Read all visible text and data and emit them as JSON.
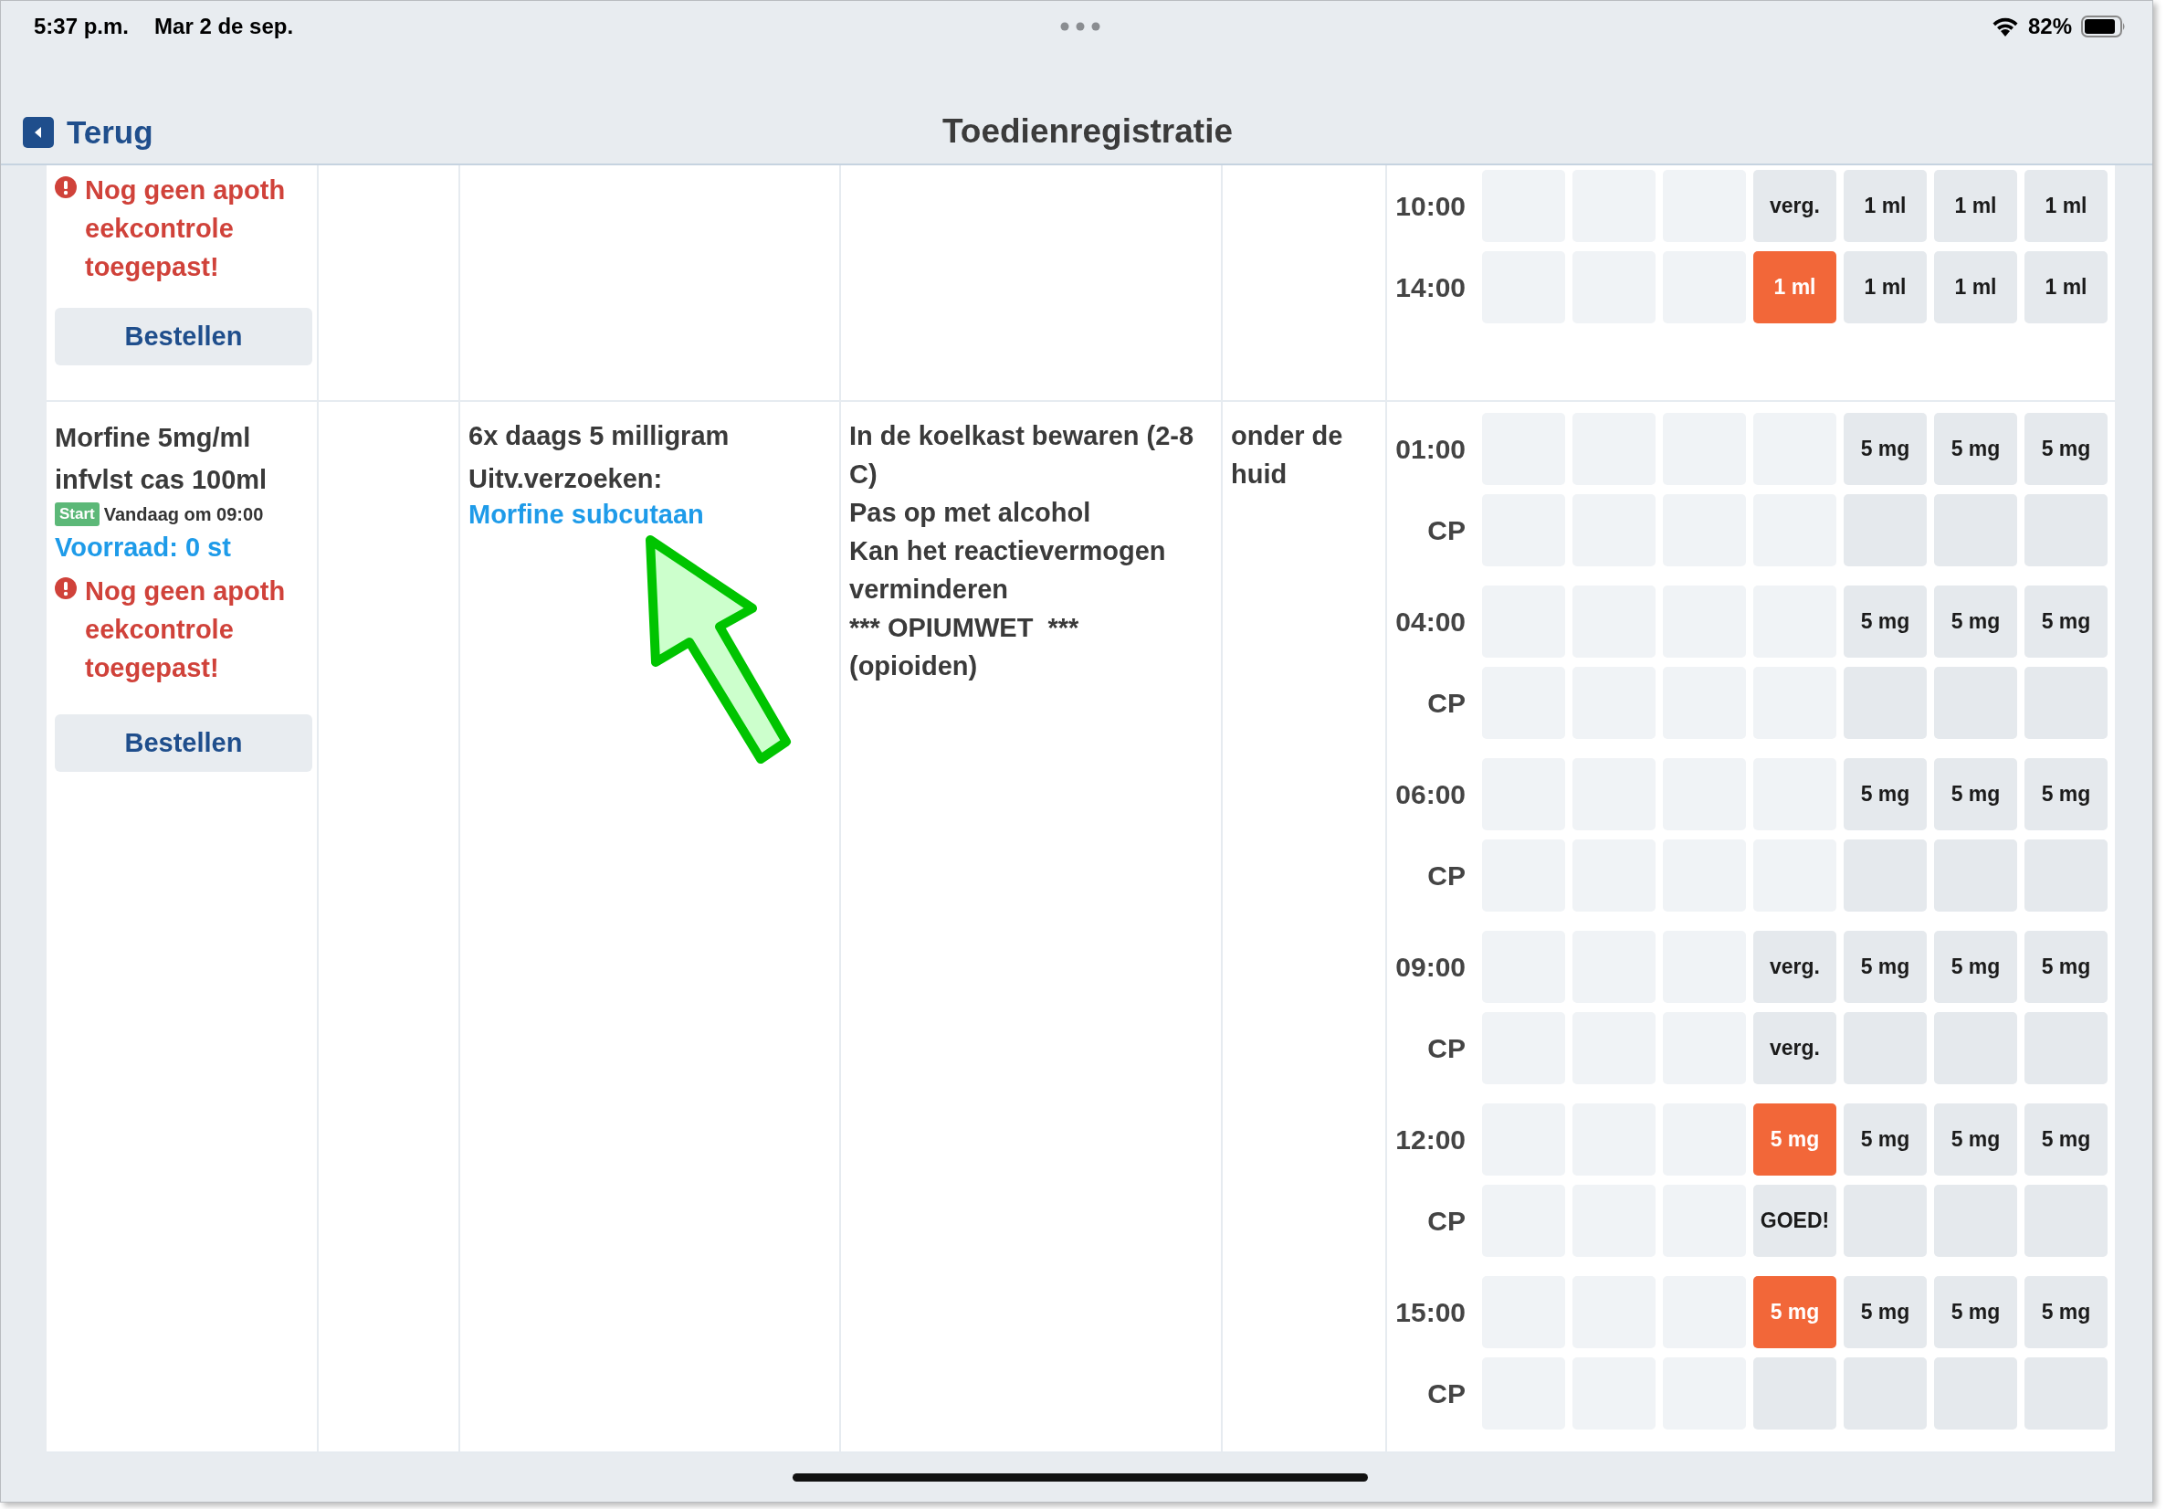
{
  "status_bar": {
    "time": "5:37 p.m.",
    "date": "Mar 2 de sep.",
    "battery": "82%"
  },
  "nav": {
    "back": "Terug",
    "title": "Toedienregistratie"
  },
  "medications": [
    {
      "warning": "Nog geen apoth\neekcontrole\ntoegepast!",
      "order_button": "Bestellen",
      "schedule": [
        {
          "lines": [
            {
              "label": "10:00",
              "cells": [
                {
                  "kind": "past"
                },
                {
                  "kind": "past"
                },
                {
                  "kind": "past"
                },
                {
                  "kind": "scheduled",
                  "text": "verg."
                },
                {
                  "kind": "scheduled",
                  "text": "1 ml"
                },
                {
                  "kind": "scheduled",
                  "text": "1 ml"
                },
                {
                  "kind": "scheduled",
                  "text": "1 ml"
                }
              ]
            },
            {
              "label": "14:00",
              "cells": [
                {
                  "kind": "past"
                },
                {
                  "kind": "past"
                },
                {
                  "kind": "past"
                },
                {
                  "kind": "overdue",
                  "text": "1 ml"
                },
                {
                  "kind": "scheduled",
                  "text": "1 ml"
                },
                {
                  "kind": "scheduled",
                  "text": "1 ml"
                },
                {
                  "kind": "scheduled",
                  "text": "1 ml"
                }
              ]
            }
          ]
        }
      ]
    },
    {
      "name": "Morfine 5mg/ml infvlst cas 100ml",
      "start_badge": "Start",
      "start_text": "Vandaag om 09:00",
      "stock": "Voorraad: 0 st",
      "warning": "Nog geen apoth\neekcontrole\ntoegepast!",
      "order_button": "Bestellen",
      "dosage": "6x daags 5 milligram",
      "requests_label": "Uitv.verzoeken:",
      "request_link": "Morfine subcutaan",
      "instructions": [
        "In de koelkast bewaren (2-8 C)",
        "Pas op met alcohol",
        "Kan het reactievermogen verminderen",
        "*** OPIUMWET  ***",
        "(opioiden)"
      ],
      "route": "onder de huid",
      "schedule": [
        {
          "lines": [
            {
              "label": "01:00",
              "cells": [
                {
                  "kind": "past"
                },
                {
                  "kind": "past"
                },
                {
                  "kind": "past"
                },
                {
                  "kind": "past"
                },
                {
                  "kind": "scheduled",
                  "text": "5 mg"
                },
                {
                  "kind": "scheduled",
                  "text": "5 mg"
                },
                {
                  "kind": "scheduled",
                  "text": "5 mg"
                }
              ]
            },
            {
              "label": "CP",
              "cells": [
                {
                  "kind": "past"
                },
                {
                  "kind": "past"
                },
                {
                  "kind": "past"
                },
                {
                  "kind": "past"
                },
                {
                  "kind": "scheduled"
                },
                {
                  "kind": "scheduled"
                },
                {
                  "kind": "scheduled"
                }
              ]
            }
          ]
        },
        {
          "lines": [
            {
              "label": "04:00",
              "cells": [
                {
                  "kind": "past"
                },
                {
                  "kind": "past"
                },
                {
                  "kind": "past"
                },
                {
                  "kind": "past"
                },
                {
                  "kind": "scheduled",
                  "text": "5 mg"
                },
                {
                  "kind": "scheduled",
                  "text": "5 mg"
                },
                {
                  "kind": "scheduled",
                  "text": "5 mg"
                }
              ]
            },
            {
              "label": "CP",
              "cells": [
                {
                  "kind": "past"
                },
                {
                  "kind": "past"
                },
                {
                  "kind": "past"
                },
                {
                  "kind": "past"
                },
                {
                  "kind": "scheduled"
                },
                {
                  "kind": "scheduled"
                },
                {
                  "kind": "scheduled"
                }
              ]
            }
          ]
        },
        {
          "lines": [
            {
              "label": "06:00",
              "cells": [
                {
                  "kind": "past"
                },
                {
                  "kind": "past"
                },
                {
                  "kind": "past"
                },
                {
                  "kind": "past"
                },
                {
                  "kind": "scheduled",
                  "text": "5 mg"
                },
                {
                  "kind": "scheduled",
                  "text": "5 mg"
                },
                {
                  "kind": "scheduled",
                  "text": "5 mg"
                }
              ]
            },
            {
              "label": "CP",
              "cells": [
                {
                  "kind": "past"
                },
                {
                  "kind": "past"
                },
                {
                  "kind": "past"
                },
                {
                  "kind": "past"
                },
                {
                  "kind": "scheduled"
                },
                {
                  "kind": "scheduled"
                },
                {
                  "kind": "scheduled"
                }
              ]
            }
          ]
        },
        {
          "lines": [
            {
              "label": "09:00",
              "cells": [
                {
                  "kind": "past"
                },
                {
                  "kind": "past"
                },
                {
                  "kind": "past"
                },
                {
                  "kind": "scheduled",
                  "text": "verg."
                },
                {
                  "kind": "scheduled",
                  "text": "5 mg"
                },
                {
                  "kind": "scheduled",
                  "text": "5 mg"
                },
                {
                  "kind": "scheduled",
                  "text": "5 mg"
                }
              ]
            },
            {
              "label": "CP",
              "cells": [
                {
                  "kind": "past"
                },
                {
                  "kind": "past"
                },
                {
                  "kind": "past"
                },
                {
                  "kind": "scheduled",
                  "text": "verg."
                },
                {
                  "kind": "scheduled"
                },
                {
                  "kind": "scheduled"
                },
                {
                  "kind": "scheduled"
                }
              ]
            }
          ]
        },
        {
          "lines": [
            {
              "label": "12:00",
              "cells": [
                {
                  "kind": "past"
                },
                {
                  "kind": "past"
                },
                {
                  "kind": "past"
                },
                {
                  "kind": "overdue",
                  "text": "5 mg"
                },
                {
                  "kind": "scheduled",
                  "text": "5 mg"
                },
                {
                  "kind": "scheduled",
                  "text": "5 mg"
                },
                {
                  "kind": "scheduled",
                  "text": "5 mg"
                }
              ]
            },
            {
              "label": "CP",
              "cells": [
                {
                  "kind": "past"
                },
                {
                  "kind": "past"
                },
                {
                  "kind": "past"
                },
                {
                  "kind": "scheduled",
                  "text": "GOED!"
                },
                {
                  "kind": "scheduled"
                },
                {
                  "kind": "scheduled"
                },
                {
                  "kind": "scheduled"
                }
              ]
            }
          ]
        },
        {
          "lines": [
            {
              "label": "15:00",
              "cells": [
                {
                  "kind": "past"
                },
                {
                  "kind": "past"
                },
                {
                  "kind": "past"
                },
                {
                  "kind": "overdue",
                  "text": "5 mg"
                },
                {
                  "kind": "scheduled",
                  "text": "5 mg"
                },
                {
                  "kind": "scheduled",
                  "text": "5 mg"
                },
                {
                  "kind": "scheduled",
                  "text": "5 mg"
                }
              ]
            },
            {
              "label": "CP",
              "cells": [
                {
                  "kind": "past"
                },
                {
                  "kind": "past"
                },
                {
                  "kind": "past"
                },
                {
                  "kind": "scheduled"
                },
                {
                  "kind": "scheduled"
                },
                {
                  "kind": "scheduled"
                },
                {
                  "kind": "scheduled"
                }
              ]
            }
          ]
        }
      ]
    }
  ]
}
